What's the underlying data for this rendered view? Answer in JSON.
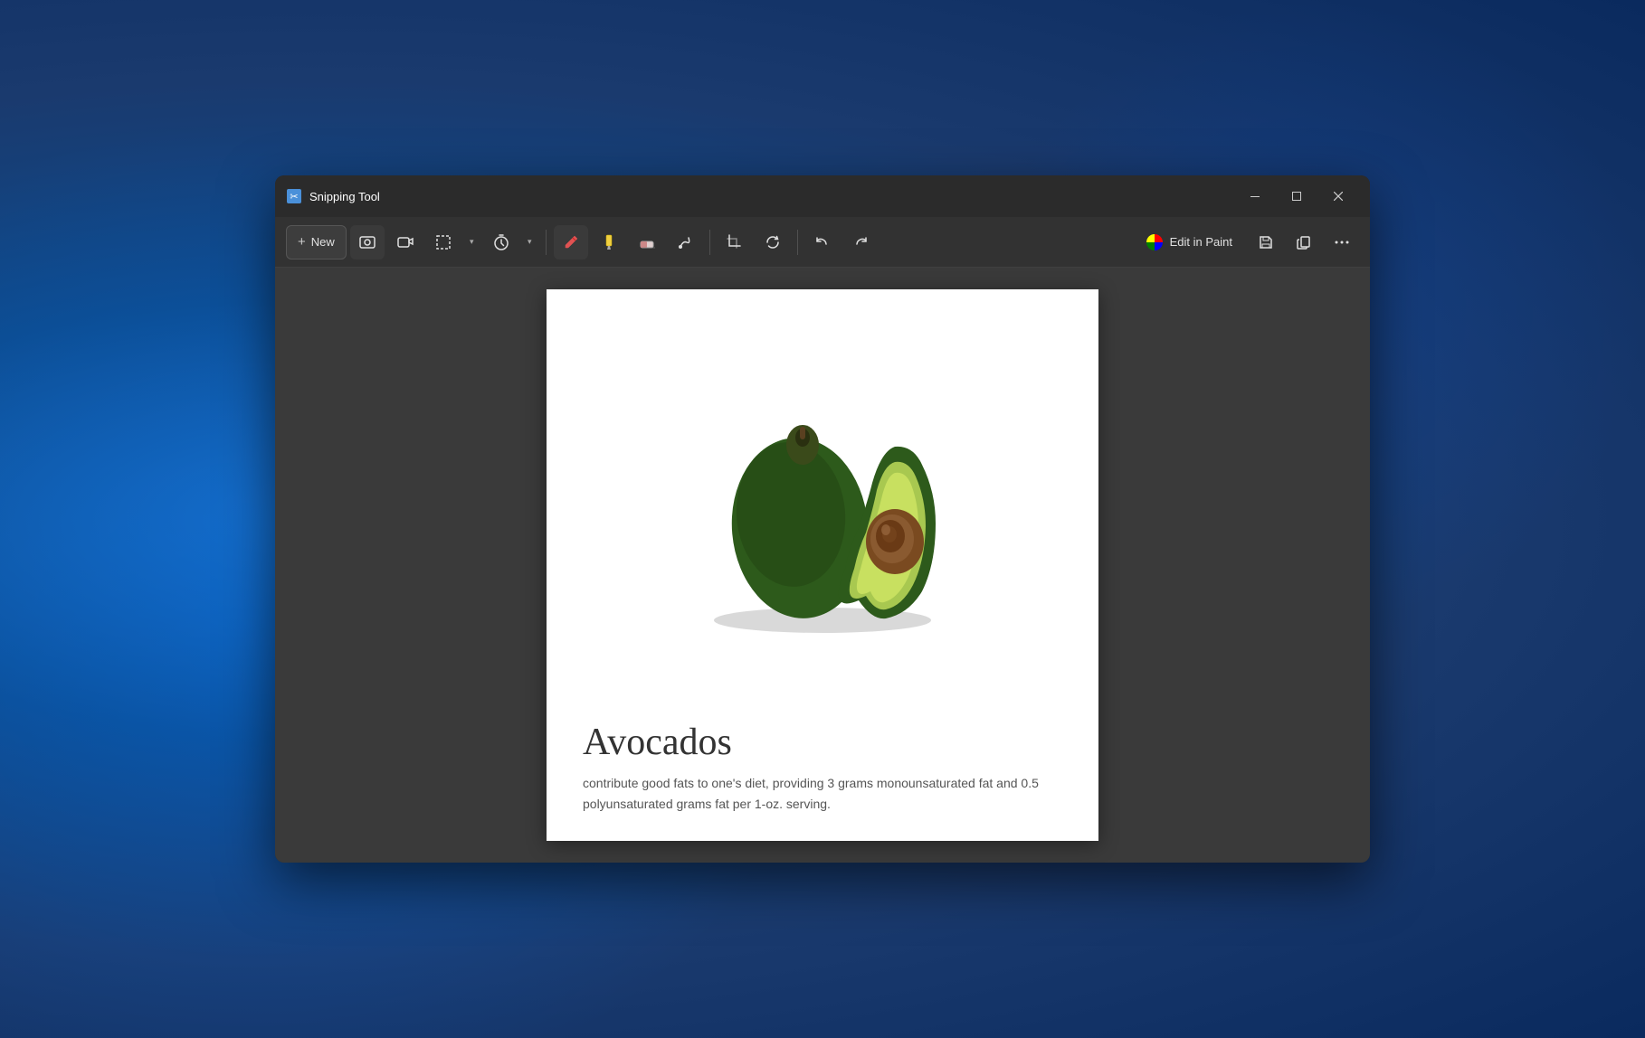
{
  "app": {
    "title": "Snipping Tool",
    "icon": "✂️"
  },
  "titlebar": {
    "title": "Snipping Tool",
    "minimize_label": "Minimize",
    "maximize_label": "Maximize",
    "close_label": "Close"
  },
  "toolbar": {
    "new_label": "New",
    "screenshot_tooltip": "Screenshot mode",
    "video_tooltip": "Video mode",
    "snip_shape_tooltip": "Snip shape",
    "delay_tooltip": "Delay",
    "pen_tooltip": "Pen",
    "highlighter_tooltip": "Highlighter",
    "eraser_tooltip": "Eraser",
    "touch_write_tooltip": "Touch writing",
    "crop_tooltip": "Crop",
    "rotate_tooltip": "Rotate",
    "undo_tooltip": "Undo",
    "redo_tooltip": "Redo",
    "edit_in_paint_label": "Edit in Paint",
    "save_tooltip": "Save",
    "copy_tooltip": "Copy",
    "more_tooltip": "More options"
  },
  "content": {
    "avocado_title": "Avocados",
    "avocado_description": "contribute good fats to one's diet, providing 3 grams monounsaturated fat and 0.5 polyunsaturated grams fat per 1-oz. serving."
  },
  "colors": {
    "window_bg": "#2b2b2b",
    "toolbar_bg": "#323232",
    "content_bg": "#3a3a3a",
    "canvas_bg": "#ffffff",
    "text_primary": "#e0e0e0",
    "accent_blue": "#0078d4"
  }
}
